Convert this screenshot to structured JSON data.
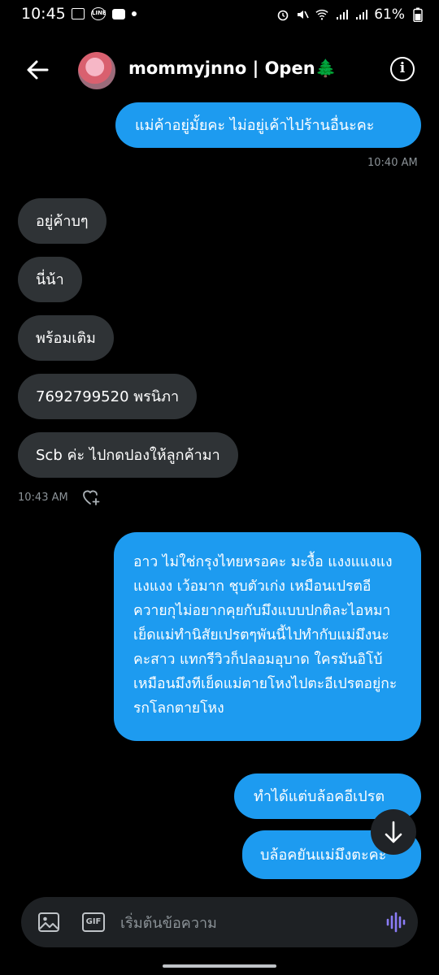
{
  "status_bar": {
    "time": "10:45",
    "battery": "61%",
    "line_label": "LINE"
  },
  "header": {
    "contact_name": "mommyjnno | Open🌲",
    "info_label": "i"
  },
  "messages": [
    {
      "dir": "out",
      "text": "แม่ค้าอยู่มั้ยคะ ไม่อยู่เค้าไปร้านอื่นะคะ"
    },
    {
      "dir": "in",
      "text": "อยู่ค้าบๆ"
    },
    {
      "dir": "in",
      "text": "นี่น้า"
    },
    {
      "dir": "in",
      "text": "พร้อมเติม"
    },
    {
      "dir": "in",
      "text": "7692799520 พรนิภา"
    },
    {
      "dir": "in",
      "text": "Scb ค่ะ ไปกดปองให้ลูกค้ามา"
    },
    {
      "dir": "out",
      "text": "อาว ไม่ใช่กรุงไทยหรอคะ มะงื้อ แงงแแงแงแงแงง เว้อมาก ชุบตัวเก่ง เหมือนเปรตอีควายกุไม่อยากคุยกับมึงแบบปกติละไอหมาเย็ดแม่ทำนิสัยเปรตๆพันนี้ไปทำกับแม่มึงนะคะสาว แทกรีวิวก็ปลอมอุบาด ใครมันอิโบ้เหมือนมึงทีเย็ดแม่ตายโหงไปตะอีเปรตอยู่กะรกโลกตายโหง"
    },
    {
      "dir": "out",
      "text": "ทำได้แต่บล้อคอีเปรต"
    },
    {
      "dir": "out",
      "text": "บล้อคยันแม่มึงตะคะ"
    }
  ],
  "timestamps": {
    "first": "10:40 AM",
    "second": "10:43 AM"
  },
  "composer": {
    "placeholder": "เริ่มต้นข้อความ",
    "gif_label": "GIF"
  },
  "icons": {
    "back": "arrow-left-icon",
    "info": "info-icon",
    "react": "heart-plus-icon",
    "scroll": "arrow-down-icon",
    "image": "image-icon",
    "gif": "gif-icon",
    "voice": "voice-wave-icon"
  },
  "colors": {
    "outgoing_bubble": "#1d9bf0",
    "incoming_bubble": "#2f3336",
    "background": "#000000",
    "voice_accent": "#8b7cf6"
  }
}
